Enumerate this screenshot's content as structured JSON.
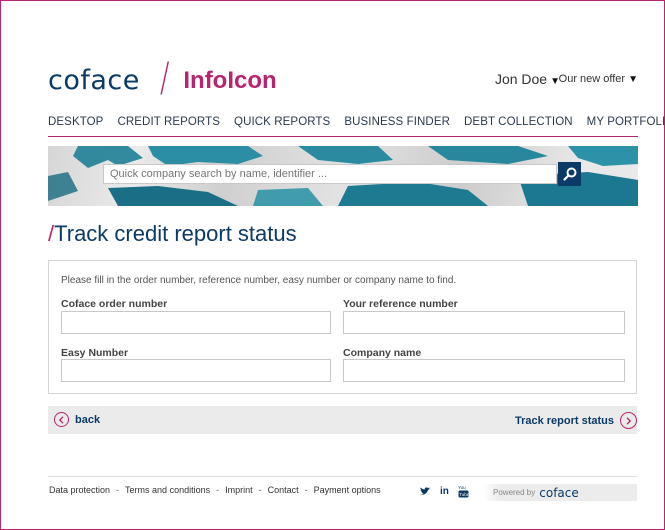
{
  "brand": {
    "logo_text": "coface",
    "product_name": "InfoIcon"
  },
  "header": {
    "user_name": "Jon Doe",
    "offer_label": "Our new offer"
  },
  "nav": {
    "items": [
      "DESKTOP",
      "CREDIT REPORTS",
      "QUICK REPORTS",
      "BUSINESS FINDER",
      "DEBT COLLECTION",
      "MY PORTFOLIO"
    ]
  },
  "search": {
    "placeholder": "Quick company search by name, identifier ..."
  },
  "page": {
    "title_slash": "/",
    "title": "Track credit report status"
  },
  "form": {
    "hint": "Please fill in the order number, reference number, easy number or company name to find.",
    "fields": [
      {
        "label": "Coface order number",
        "value": ""
      },
      {
        "label": "Your reference number",
        "value": ""
      },
      {
        "label": "Easy Number",
        "value": ""
      },
      {
        "label": "Company name",
        "value": ""
      }
    ]
  },
  "actions": {
    "back_label": "back",
    "track_label": "Track report status"
  },
  "footer": {
    "links": [
      "Data protection",
      "Terms and conditions",
      "Imprint",
      "Contact",
      "Payment options"
    ],
    "separator": "-",
    "powered_by": "Powered by",
    "powered_logo": "coface",
    "social_icons": [
      "twitter-icon",
      "linkedin-icon",
      "youtube-icon"
    ]
  },
  "colors": {
    "brand_magenta": "#b8246e",
    "brand_navy": "#0c3a66",
    "banner_teal": "#1f7f96"
  }
}
